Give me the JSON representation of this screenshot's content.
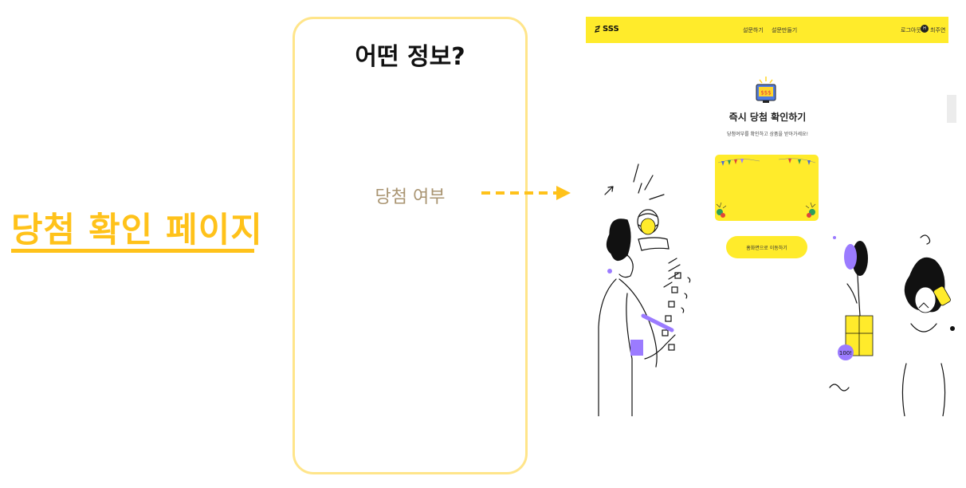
{
  "page": {
    "title": "당첨 확인 페이지"
  },
  "info_card": {
    "heading": "어떤 정보?",
    "item": "당첨 여부"
  },
  "screenshot": {
    "nav": {
      "logo": "SSS",
      "links": [
        "설문하기",
        "설문만들기"
      ],
      "logout": "로그아웃",
      "user_name": "최주연",
      "user_initial": "H"
    },
    "headline": "즉시 당첨 확인하기",
    "subline": "당첨여부를 확인하고 상품을 받아가세요!",
    "home_button": "홈화면으로 이동하기",
    "icons": {
      "prize": "money-screen-icon",
      "badge_text": "100!"
    }
  },
  "colors": {
    "accent": "#FFC21A",
    "brand_yellow": "#FFEB2B",
    "card_border": "#FFE58A",
    "info_text": "#A99471",
    "purple": "#9B7BFF"
  }
}
